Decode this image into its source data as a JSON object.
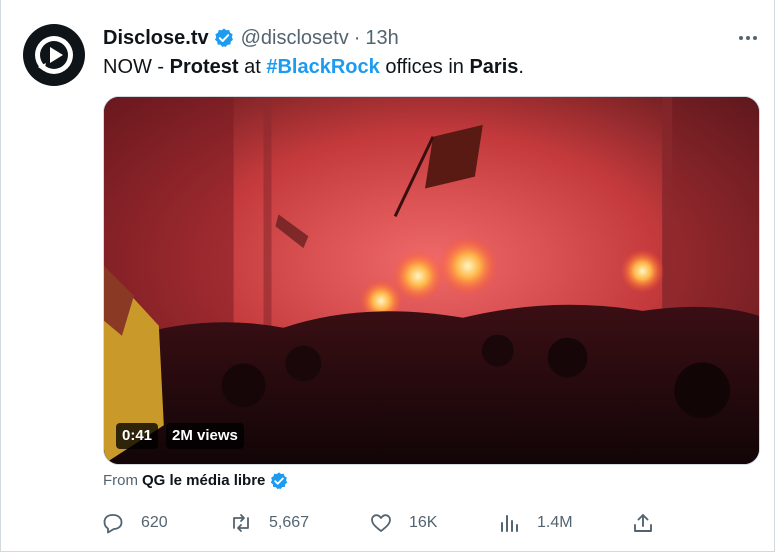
{
  "tweet": {
    "author_name": "Disclose.tv",
    "handle": "@disclosetv",
    "separator": "·",
    "time": "13h",
    "text_prefix": "NOW - ",
    "text_bold_1": "Protest",
    "text_mid_1": " at ",
    "hashtag": "#BlackRock",
    "text_mid_2": " offices in ",
    "text_bold_2": "Paris",
    "text_suffix": "."
  },
  "media": {
    "duration": "0:41",
    "views": "2M views"
  },
  "source": {
    "prefix": "From",
    "name": "QG le média libre"
  },
  "actions": {
    "replies": "620",
    "reposts": "5,667",
    "likes": "16K",
    "views": "1.4M"
  },
  "icons": {
    "avatar": "disclose-play-logo",
    "verified": "verified-badge-icon",
    "more": "more-options-icon",
    "reply": "reply-icon",
    "repost": "repost-icon",
    "like": "heart-icon",
    "views": "analytics-icon",
    "share": "share-icon"
  },
  "colors": {
    "accent": "#1d9bf0",
    "text": "#0f1419",
    "muted": "#536471"
  }
}
